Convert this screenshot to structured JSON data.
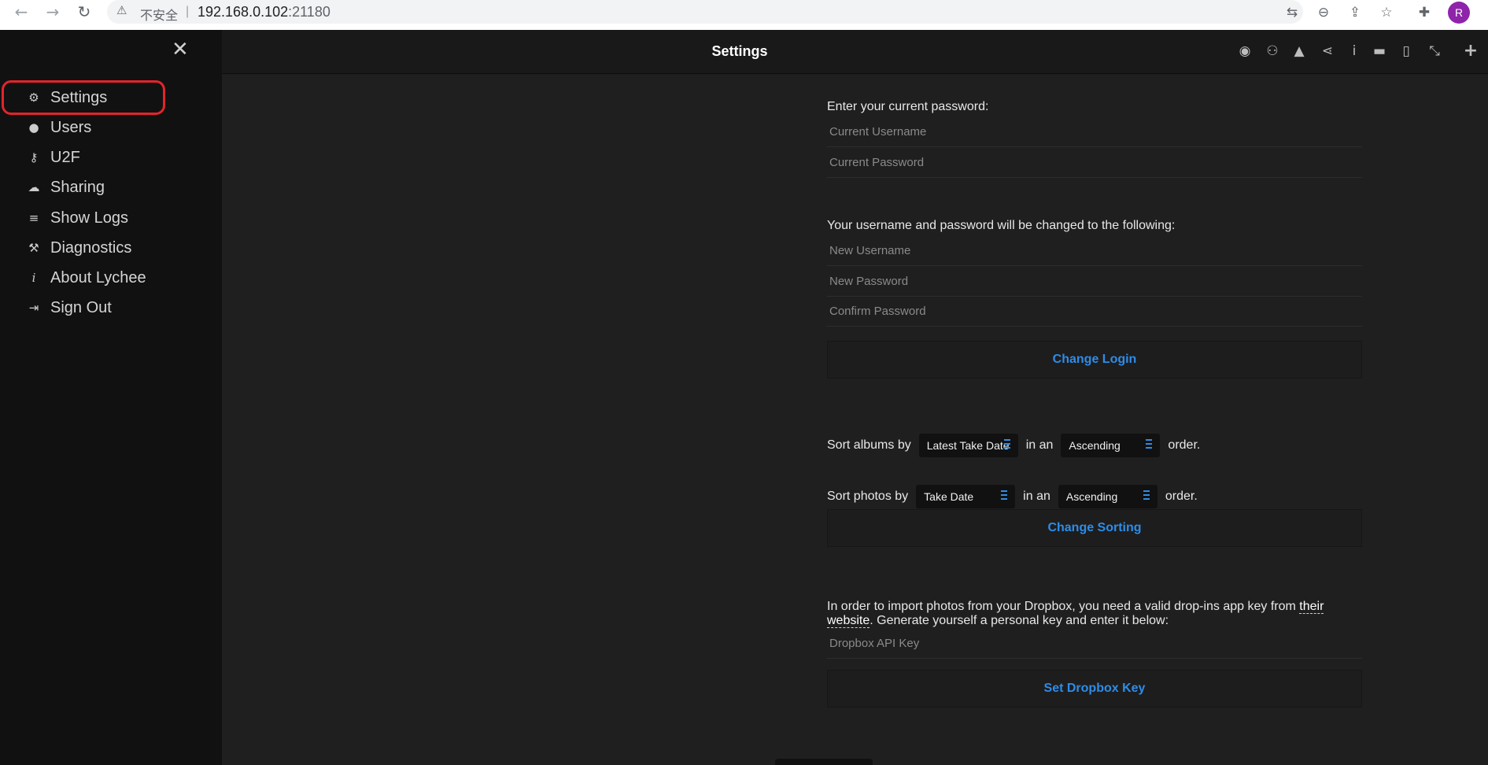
{
  "browser": {
    "back_icon": "arrow-left-icon",
    "forward_icon": "arrow-right-icon",
    "reload_icon": "reload-icon",
    "security_label": "不安全",
    "url_host": "192.168.0.102",
    "url_port": ":21180",
    "profile_initial": "R"
  },
  "sidebar": {
    "close_icon": "close-icon",
    "items": [
      {
        "label": "Settings",
        "icon": "gear-icon"
      },
      {
        "label": "Users",
        "icon": "user-icon"
      },
      {
        "label": "U2F",
        "icon": "key-icon"
      },
      {
        "label": "Sharing",
        "icon": "cloud-icon"
      },
      {
        "label": "Show Logs",
        "icon": "list-icon"
      },
      {
        "label": "Diagnostics",
        "icon": "wrench-icon"
      },
      {
        "label": "About Lychee",
        "icon": "info-icon"
      },
      {
        "label": "Sign Out",
        "icon": "sign-out-icon"
      }
    ],
    "highlight_color": "#e3242b"
  },
  "header": {
    "title": "Settings"
  },
  "login": {
    "current_prompt": "Enter your current password:",
    "current_username_placeholder": "Current Username",
    "current_password_placeholder": "Current Password",
    "new_prompt": "Your username and password will be changed to the following:",
    "new_username_placeholder": "New Username",
    "new_password_placeholder": "New Password",
    "confirm_password_placeholder": "Confirm Password",
    "change_button": "Change Login"
  },
  "sorting": {
    "albums_prefix": "Sort albums by",
    "albums_by": "Latest Take Date",
    "albums_order": "Ascending",
    "photos_prefix": "Sort photos by",
    "photos_by": "Take Date",
    "photos_order": "Ascending",
    "in_an": "in an",
    "order_suffix": "order.",
    "change_button": "Change Sorting"
  },
  "dropbox": {
    "text_before": "In order to import photos from your Dropbox, you need a valid drop-ins app key from ",
    "link_text": "their website",
    "text_after": ". Generate yourself a personal key and enter it below:",
    "key_placeholder": "Dropbox API Key",
    "set_button": "Set Dropbox Key"
  },
  "colors": {
    "accent": "#2e8ce8",
    "background": "#1f1f1f",
    "sidebar_bg": "#111111"
  }
}
